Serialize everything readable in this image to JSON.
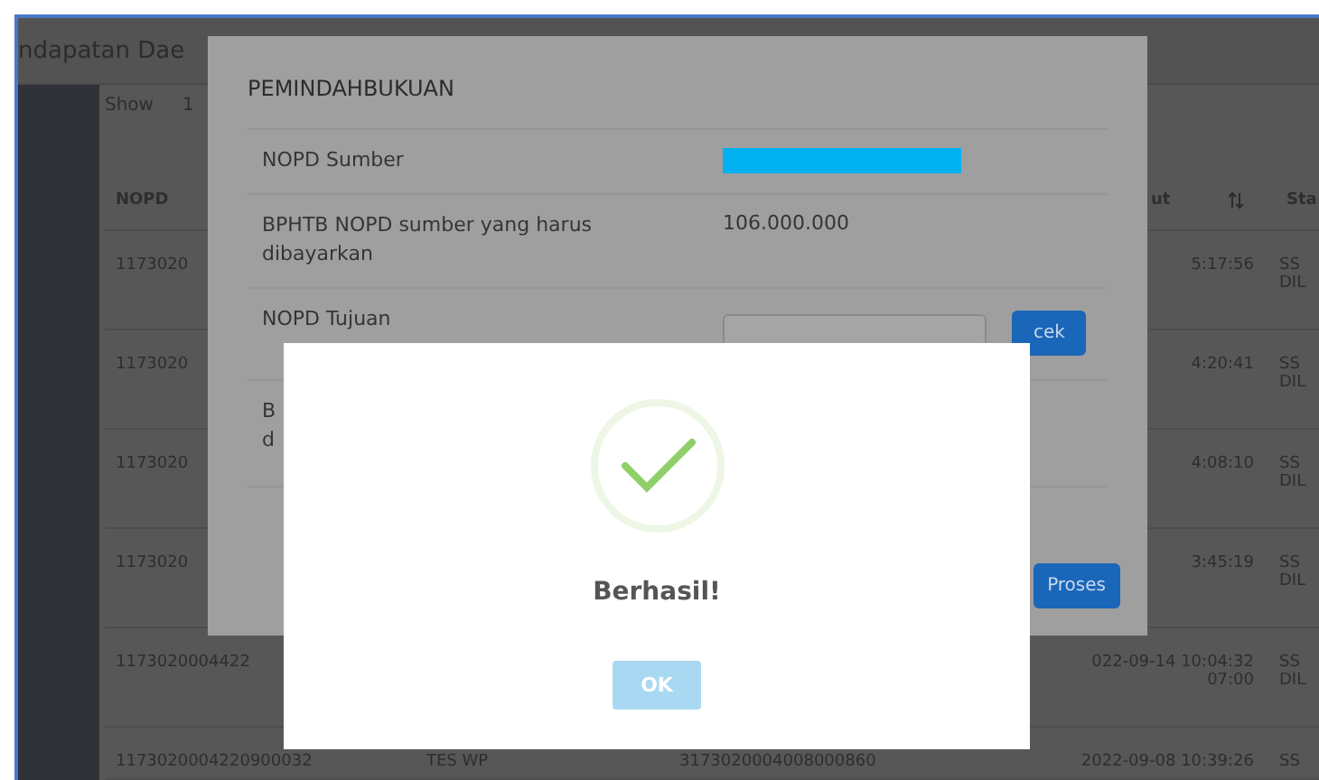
{
  "page": {
    "title": "ndapatan Dae",
    "show_label": "Show",
    "show_value": "1"
  },
  "table": {
    "columns": [
      {
        "label": "NOPD"
      },
      null,
      null,
      {
        "label": "ut",
        "sortable": true
      },
      {
        "label": "Sta"
      }
    ],
    "rows": [
      {
        "cells": [
          "1173020",
          "",
          "",
          "5:17:56",
          "SS\nDIL"
        ]
      },
      {
        "cells": [
          "1173020",
          "",
          "",
          "4:20:41",
          "SS\nDIL"
        ]
      },
      {
        "cells": [
          "1173020",
          "",
          "",
          "4:08:10",
          "SS\nDIL"
        ]
      },
      {
        "cells": [
          "1173020",
          "",
          "",
          "3:45:19",
          "SS\nDIL"
        ]
      },
      {
        "cells": [
          "1173020004422",
          "",
          "",
          "022-09-14 10:04:32\n07:00",
          "SS\nDIL"
        ]
      },
      {
        "cells": [
          "1173020004220900032",
          "TES WP",
          "3173020004008000860",
          "2022-09-08 10:39:26",
          "SS"
        ]
      }
    ]
  },
  "modal": {
    "title": "PEMINDAHBUKUAN",
    "rows": [
      {
        "kind": "redacted",
        "label": "NOPD Sumber"
      },
      {
        "kind": "text",
        "label": "BPHTB NOPD sumber yang harus dibayarkan",
        "value": "106.000.000"
      },
      {
        "kind": "input",
        "label": "NOPD Tujuan",
        "button": "cek"
      },
      {
        "kind": "partial",
        "label_lines": [
          "B",
          "d"
        ]
      }
    ],
    "submit": "Proses"
  },
  "alert": {
    "title": "Berhasil!",
    "button": "OK"
  }
}
